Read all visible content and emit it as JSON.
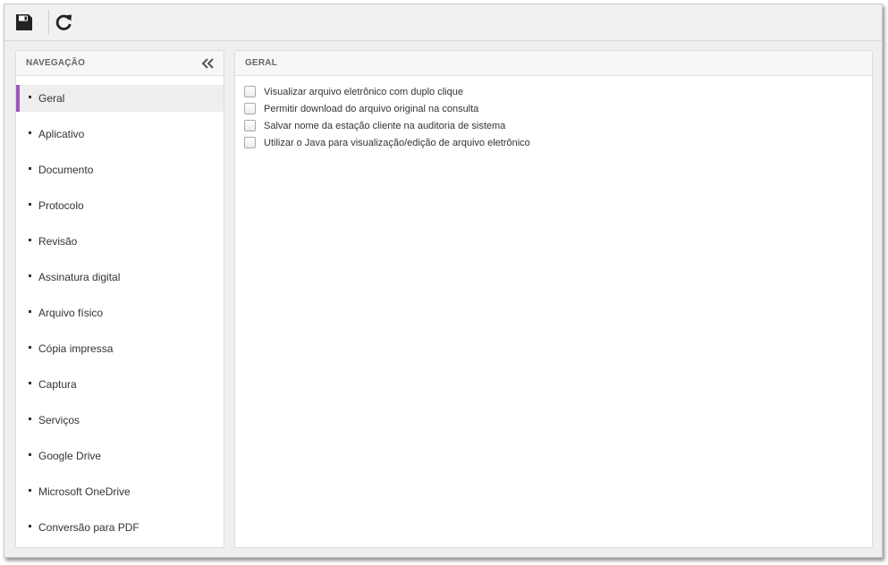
{
  "toolbar": {
    "save_icon": "floppy-disk-save-icon",
    "refresh_icon": "refresh-icon"
  },
  "navigation": {
    "title": "NAVEGAÇÃO",
    "collapse_icon": "double-chevron-left-icon",
    "active_color": "#9b59b6",
    "items": [
      {
        "label": "Geral",
        "active": true
      },
      {
        "label": "Aplicativo",
        "active": false
      },
      {
        "label": "Documento",
        "active": false
      },
      {
        "label": "Protocolo",
        "active": false
      },
      {
        "label": "Revisão",
        "active": false
      },
      {
        "label": "Assinatura digital",
        "active": false
      },
      {
        "label": "Arquivo físico",
        "active": false
      },
      {
        "label": "Cópia impressa",
        "active": false
      },
      {
        "label": "Captura",
        "active": false
      },
      {
        "label": "Serviços",
        "active": false
      },
      {
        "label": "Google Drive",
        "active": false
      },
      {
        "label": "Microsoft OneDrive",
        "active": false
      },
      {
        "label": "Conversão para PDF",
        "active": false
      }
    ]
  },
  "content": {
    "title": "GERAL",
    "options": [
      {
        "label": "Visualizar arquivo eletrônico com duplo clique",
        "checked": false
      },
      {
        "label": "Permitir download do arquivo original na consulta",
        "checked": false
      },
      {
        "label": "Salvar nome da estação cliente na auditoria de sistema",
        "checked": false
      },
      {
        "label": "Utilizar o Java para visualização/edição de arquivo eletrônico",
        "checked": false
      }
    ]
  }
}
